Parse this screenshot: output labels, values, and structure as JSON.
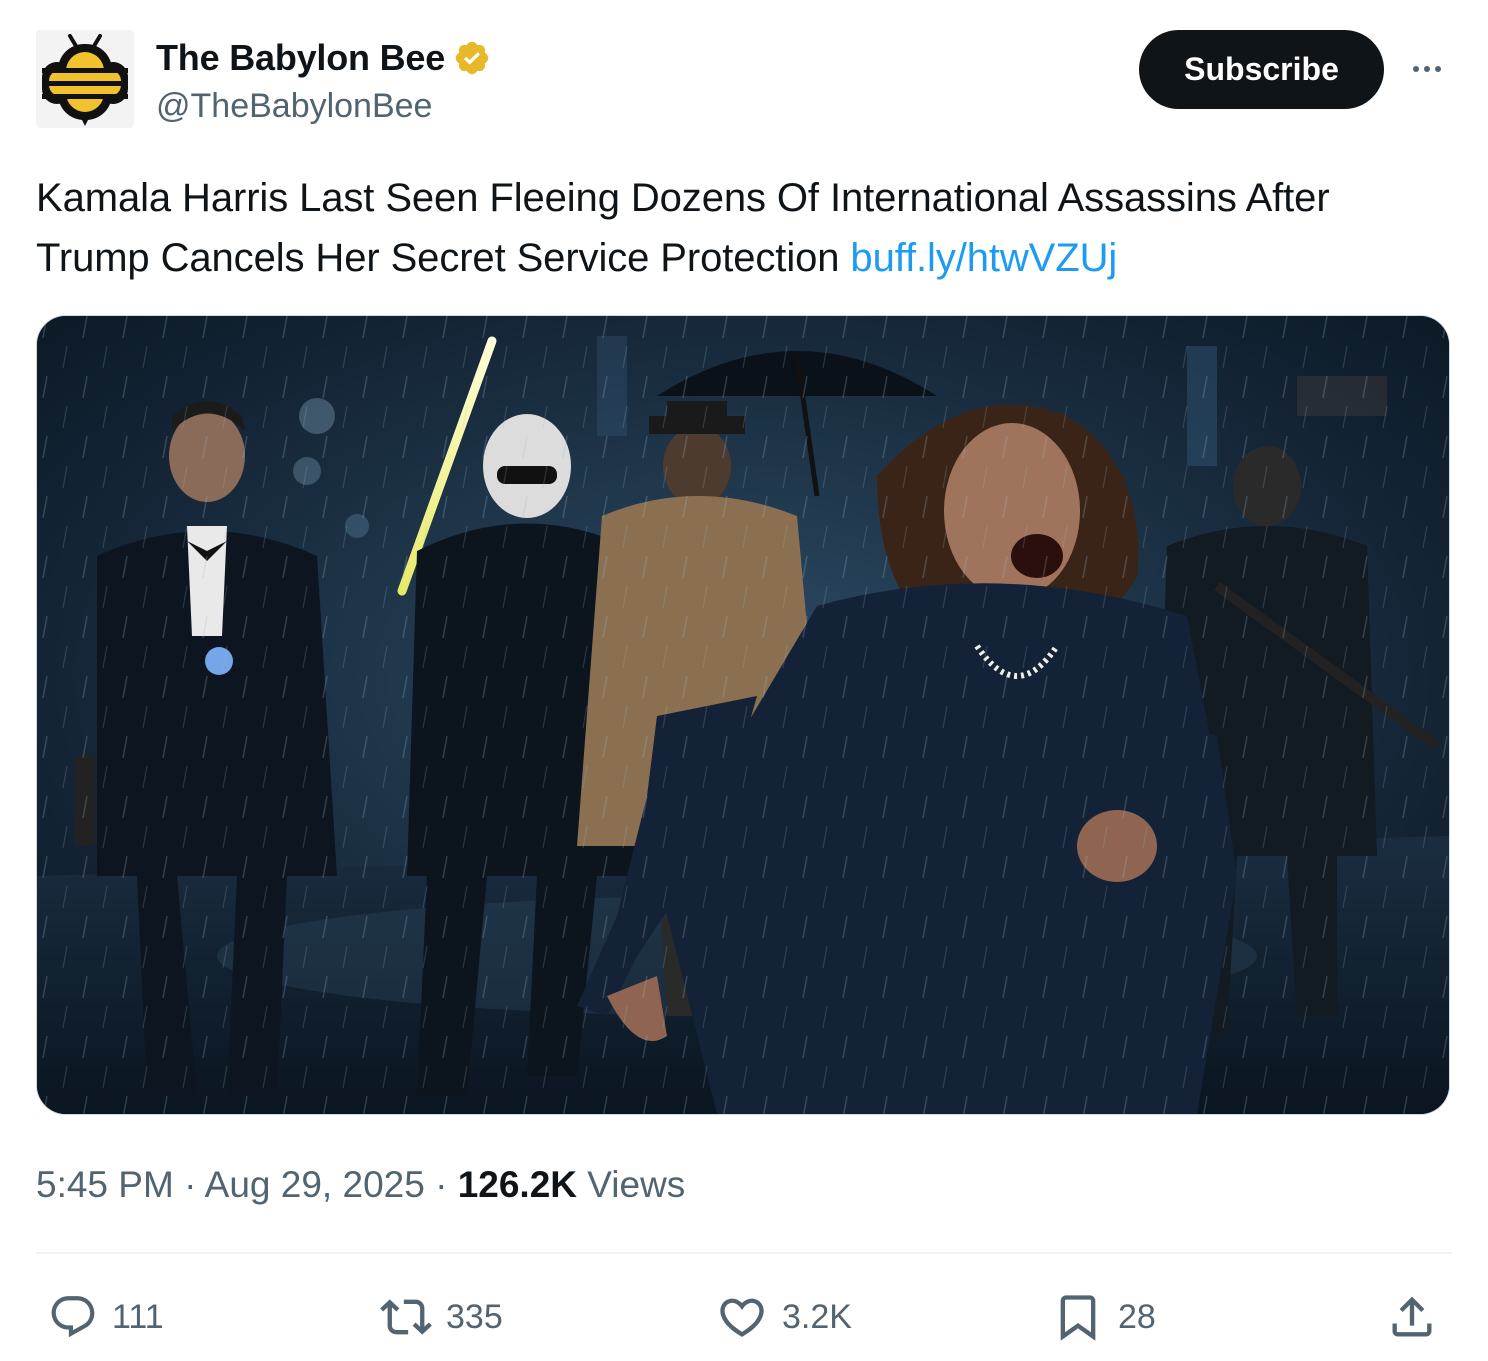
{
  "author": {
    "display_name": "The Babylon Bee",
    "handle": "@TheBabylonBee",
    "verified_badge": "gold-verified-badge-icon",
    "brand_colors": {
      "logo_yellow": "#f2c12e",
      "logo_dark": "#111111",
      "badge_gold": "#e8b829"
    }
  },
  "header": {
    "subscribe_label": "Subscribe",
    "more_icon": "more-horizontal-icon"
  },
  "tweet": {
    "text": "Kamala Harris Last Seen Fleeing Dozens Of International Assassins After Trump Cancels Her Secret Service Protection",
    "link_text": "buff.ly/htwVZUj",
    "link_color": "#1d9bf0"
  },
  "media": {
    "type": "image"
  },
  "meta": {
    "time": "5:45 PM",
    "separator": "·",
    "date": "Aug 29, 2025",
    "views_count": "126.2K",
    "views_label": "Views"
  },
  "actions": {
    "reply": {
      "icon": "reply-icon",
      "count": "111"
    },
    "repost": {
      "icon": "repost-icon",
      "count": "335"
    },
    "like": {
      "icon": "heart-icon",
      "count": "3.2K"
    },
    "bookmark": {
      "icon": "bookmark-icon",
      "count": "28"
    },
    "share": {
      "icon": "share-icon"
    }
  }
}
